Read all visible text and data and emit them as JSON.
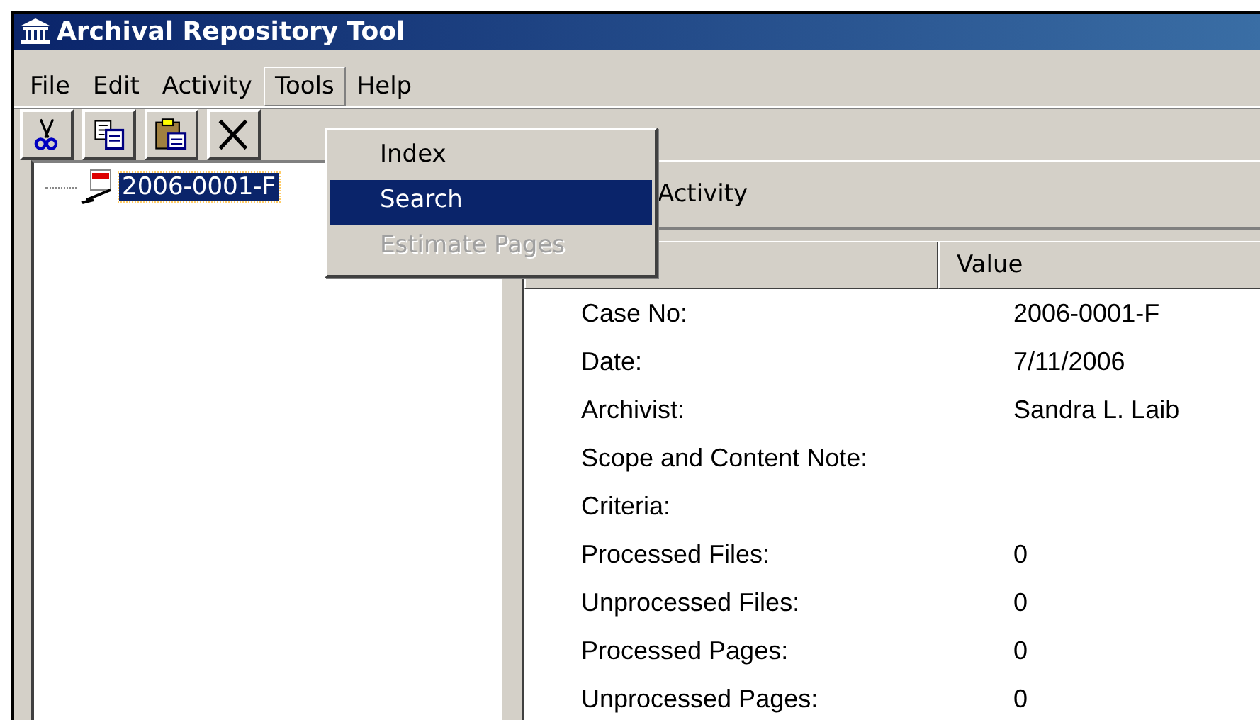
{
  "window": {
    "title": "Archival Repository Tool"
  },
  "menu_bar": [
    {
      "label": "File",
      "selected": false
    },
    {
      "label": "Edit",
      "selected": false
    },
    {
      "label": "Activity",
      "selected": false
    },
    {
      "label": "Tools",
      "selected": true
    },
    {
      "label": "Help",
      "selected": false
    }
  ],
  "toolbar": [
    {
      "kind": "cut"
    },
    {
      "kind": "copy"
    },
    {
      "kind": "paste"
    },
    {
      "kind": "delete"
    }
  ],
  "open_menu": [
    {
      "label": "Index",
      "selected": false,
      "disabled": false
    },
    {
      "label": "Search",
      "selected": true,
      "disabled": false
    },
    {
      "label": "Estimate Pages",
      "selected": false,
      "disabled": true
    }
  ],
  "tree": [
    {
      "label": "2006-0001-F",
      "selected": true
    }
  ],
  "panel": {
    "title": "Activity"
  },
  "table": {
    "value_heading": "Value",
    "rows": [
      {
        "field": "Case No:",
        "value": "2006-0001-F"
      },
      {
        "field": "Date:",
        "value": "7/11/2006"
      },
      {
        "field": "Archivist:",
        "value": "Sandra L. Laib"
      },
      {
        "field": "Scope and Content Note:"
      },
      {
        "field": "Criteria:"
      },
      {
        "field": "Processed Files:",
        "value": "0"
      },
      {
        "field": "Unprocessed Files:",
        "value": "0"
      },
      {
        "field": "Processed Pages:",
        "value": "0"
      },
      {
        "field": "Unprocessed Pages:",
        "value": "0"
      }
    ]
  }
}
